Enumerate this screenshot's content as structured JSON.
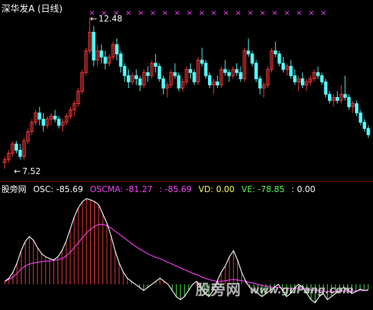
{
  "main_panel": {
    "title": "深华发A (日线)",
    "high_label": "12.48",
    "low_label": "7.52",
    "high_arrow": "←",
    "low_arrow": "←",
    "x_marker": "×",
    "x_marker_count": 20
  },
  "indicator_panel": {
    "name": "股旁网",
    "osc_label": "OSC:",
    "osc_value": "-85.69",
    "oscma_label": "OSCMA:",
    "oscma_value": "-81.27",
    "sep_label": ":",
    "sep_value": "-85.69",
    "vd_label": "VD:",
    "vd_value": "0.00",
    "ve_label": "VE:",
    "ve_value": "-78.85",
    "last_label": ":",
    "last_value": "0.00"
  },
  "watermark": {
    "text": "股旁网",
    "url": "www.guPang.com"
  },
  "colors": {
    "background": "#000000",
    "up": "#ff3b3b",
    "down": "#54ffff",
    "marker": "#ff44ff",
    "title": "#ffffff",
    "osc": "#ffffff",
    "oscma": "#ff44ff",
    "vd": "#ffff55",
    "ve": "#55ff55"
  },
  "chart_data": [
    {
      "type": "candlestick",
      "title": "深华发A (日线)",
      "labels": [
        "12.48",
        "7.52"
      ],
      "high": 12.48,
      "low": 7.52,
      "candles": [
        [
          7.8,
          8.0,
          7.6,
          7.9
        ],
        [
          7.9,
          8.2,
          7.8,
          8.1
        ],
        [
          8.1,
          8.5,
          8.0,
          8.4
        ],
        [
          8.4,
          8.5,
          8.1,
          8.2
        ],
        [
          8.2,
          8.4,
          7.9,
          8.0
        ],
        [
          8.0,
          8.6,
          7.9,
          8.5
        ],
        [
          8.5,
          8.9,
          8.4,
          8.8
        ],
        [
          8.8,
          9.2,
          8.7,
          9.1
        ],
        [
          9.1,
          9.5,
          9.0,
          9.4
        ],
        [
          9.4,
          9.6,
          9.0,
          9.2
        ],
        [
          9.2,
          9.4,
          8.8,
          9.0
        ],
        [
          9.0,
          9.3,
          8.9,
          9.2
        ],
        [
          9.2,
          9.4,
          9.0,
          9.3
        ],
        [
          9.3,
          9.5,
          9.1,
          9.2
        ],
        [
          9.2,
          9.3,
          8.9,
          9.0
        ],
        [
          9.0,
          9.2,
          8.8,
          9.1
        ],
        [
          9.1,
          9.4,
          9.0,
          9.3
        ],
        [
          9.3,
          9.6,
          9.2,
          9.5
        ],
        [
          9.5,
          9.8,
          9.3,
          9.7
        ],
        [
          9.7,
          10.2,
          9.6,
          10.1
        ],
        [
          10.1,
          10.8,
          10.0,
          10.7
        ],
        [
          10.7,
          11.5,
          10.6,
          11.4
        ],
        [
          11.4,
          12.48,
          11.3,
          12.0
        ],
        [
          12.0,
          12.2,
          10.9,
          11.1
        ],
        [
          11.1,
          11.6,
          10.9,
          11.4
        ],
        [
          11.4,
          11.6,
          11.0,
          11.2
        ],
        [
          11.2,
          11.4,
          10.8,
          11.0
        ],
        [
          11.0,
          11.3,
          10.9,
          11.2
        ],
        [
          11.2,
          11.7,
          11.1,
          11.6
        ],
        [
          11.6,
          11.8,
          11.1,
          11.3
        ],
        [
          11.3,
          11.4,
          10.7,
          10.9
        ],
        [
          10.9,
          11.0,
          10.4,
          10.6
        ],
        [
          10.6,
          10.8,
          10.2,
          10.4
        ],
        [
          10.4,
          10.7,
          10.3,
          10.6
        ],
        [
          10.6,
          10.8,
          10.3,
          10.5
        ],
        [
          10.5,
          10.6,
          10.1,
          10.3
        ],
        [
          10.3,
          10.8,
          10.2,
          10.7
        ],
        [
          10.7,
          10.9,
          10.4,
          10.6
        ],
        [
          10.6,
          11.1,
          10.5,
          11.0
        ],
        [
          11.0,
          11.3,
          10.7,
          10.9
        ],
        [
          10.9,
          11.0,
          10.4,
          10.5
        ],
        [
          10.5,
          10.6,
          10.0,
          10.2
        ],
        [
          10.2,
          10.4,
          9.9,
          10.3
        ],
        [
          10.3,
          10.8,
          10.2,
          10.7
        ],
        [
          10.7,
          11.0,
          10.5,
          10.6
        ],
        [
          10.6,
          10.7,
          10.1,
          10.2
        ],
        [
          10.2,
          10.5,
          10.1,
          10.4
        ],
        [
          10.4,
          10.9,
          10.3,
          10.8
        ],
        [
          10.8,
          11.0,
          10.5,
          10.7
        ],
        [
          10.7,
          10.8,
          10.3,
          10.4
        ],
        [
          10.4,
          11.2,
          10.3,
          11.1
        ],
        [
          11.1,
          11.5,
          10.9,
          11.0
        ],
        [
          11.0,
          11.1,
          10.5,
          10.6
        ],
        [
          10.6,
          10.7,
          10.2,
          10.3
        ],
        [
          10.3,
          10.5,
          10.0,
          10.4
        ],
        [
          10.4,
          10.6,
          10.2,
          10.3
        ],
        [
          10.3,
          10.9,
          10.2,
          10.8
        ],
        [
          10.8,
          11.1,
          10.6,
          10.7
        ],
        [
          10.7,
          10.8,
          10.4,
          10.6
        ],
        [
          10.6,
          10.9,
          10.5,
          10.8
        ],
        [
          10.8,
          11.0,
          10.6,
          10.7
        ],
        [
          10.7,
          10.9,
          10.4,
          10.5
        ],
        [
          10.5,
          11.5,
          10.4,
          11.4
        ],
        [
          11.4,
          11.8,
          11.2,
          11.3
        ],
        [
          11.3,
          11.4,
          10.9,
          11.0
        ],
        [
          11.0,
          11.1,
          10.4,
          10.5
        ],
        [
          10.5,
          10.6,
          10.0,
          10.2
        ],
        [
          10.2,
          10.4,
          9.9,
          10.3
        ],
        [
          10.3,
          10.9,
          10.2,
          10.8
        ],
        [
          10.8,
          11.5,
          10.7,
          11.4
        ],
        [
          11.4,
          11.7,
          11.2,
          11.3
        ],
        [
          11.3,
          11.4,
          10.9,
          11.0
        ],
        [
          11.0,
          11.2,
          10.7,
          10.8
        ],
        [
          10.8,
          11.0,
          10.6,
          10.9
        ],
        [
          10.9,
          11.1,
          10.5,
          10.6
        ],
        [
          10.6,
          10.8,
          10.3,
          10.4
        ],
        [
          10.4,
          10.6,
          10.1,
          10.5
        ],
        [
          10.5,
          10.7,
          10.2,
          10.3
        ],
        [
          10.3,
          10.5,
          10.1,
          10.4
        ],
        [
          10.4,
          10.6,
          10.3,
          10.5
        ],
        [
          10.5,
          10.8,
          10.4,
          10.7
        ],
        [
          10.7,
          10.9,
          10.5,
          10.6
        ],
        [
          10.6,
          10.7,
          10.3,
          10.4
        ],
        [
          10.4,
          10.5,
          9.9,
          10.0
        ],
        [
          10.0,
          10.1,
          9.7,
          9.8
        ],
        [
          9.8,
          10.0,
          9.6,
          9.9
        ],
        [
          9.9,
          10.1,
          9.7,
          9.8
        ],
        [
          9.8,
          10.3,
          9.7,
          10.0
        ],
        [
          10.0,
          10.6,
          9.8,
          9.9
        ],
        [
          9.9,
          10.0,
          9.5,
          9.6
        ],
        [
          9.6,
          9.8,
          9.4,
          9.7
        ],
        [
          9.7,
          9.8,
          9.3,
          9.4
        ],
        [
          9.4,
          9.5,
          9.0,
          9.1
        ],
        [
          9.1,
          9.2,
          8.8,
          8.9
        ],
        [
          8.9,
          9.0,
          8.6,
          8.7
        ]
      ]
    },
    {
      "type": "line",
      "series": [
        {
          "name": "OSC",
          "values": [
            5,
            10,
            20,
            35,
            55,
            70,
            78,
            72,
            60,
            50,
            45,
            42,
            40,
            45,
            55,
            70,
            90,
            110,
            125,
            135,
            140,
            138,
            135,
            130,
            115,
            100,
            80,
            55,
            35,
            20,
            10,
            5,
            0,
            -5,
            -10,
            -5,
            0,
            5,
            10,
            5,
            0,
            -10,
            -20,
            -25,
            -20,
            -10,
            0,
            5,
            -5,
            -15,
            -20,
            -10,
            5,
            20,
            30,
            45,
            55,
            40,
            20,
            5,
            -5,
            -10,
            -15,
            -20,
            -15,
            -10,
            -5,
            0,
            -10,
            -20,
            -15,
            -5,
            0,
            -5,
            -15,
            -25,
            -30,
            -20,
            -15,
            -25,
            -20,
            -15,
            -10,
            -5,
            -10,
            -15,
            -12,
            -8,
            -10,
            -9
          ]
        },
        {
          "name": "OSCMA",
          "values": [
            5,
            8,
            12,
            18,
            25,
            30,
            33,
            35,
            36,
            37,
            38,
            38,
            39,
            40,
            42,
            46,
            52,
            60,
            68,
            76,
            84,
            90,
            95,
            98,
            98,
            96,
            92,
            87,
            82,
            77,
            72,
            67,
            62,
            58,
            54,
            50,
            47,
            44,
            42,
            39,
            36,
            33,
            30,
            27,
            24,
            21,
            18,
            16,
            13,
            10,
            8,
            6,
            5,
            5,
            6,
            7,
            8,
            7,
            6,
            5,
            3,
            2,
            0,
            -2,
            -3,
            -4,
            -5,
            -5,
            -6,
            -7,
            -7,
            -6,
            -6,
            -7,
            -8,
            -9,
            -10,
            -10,
            -11,
            -12,
            -12,
            -12,
            -12,
            -11,
            -11,
            -11,
            -11,
            -10,
            -10,
            -10
          ]
        }
      ]
    }
  ]
}
